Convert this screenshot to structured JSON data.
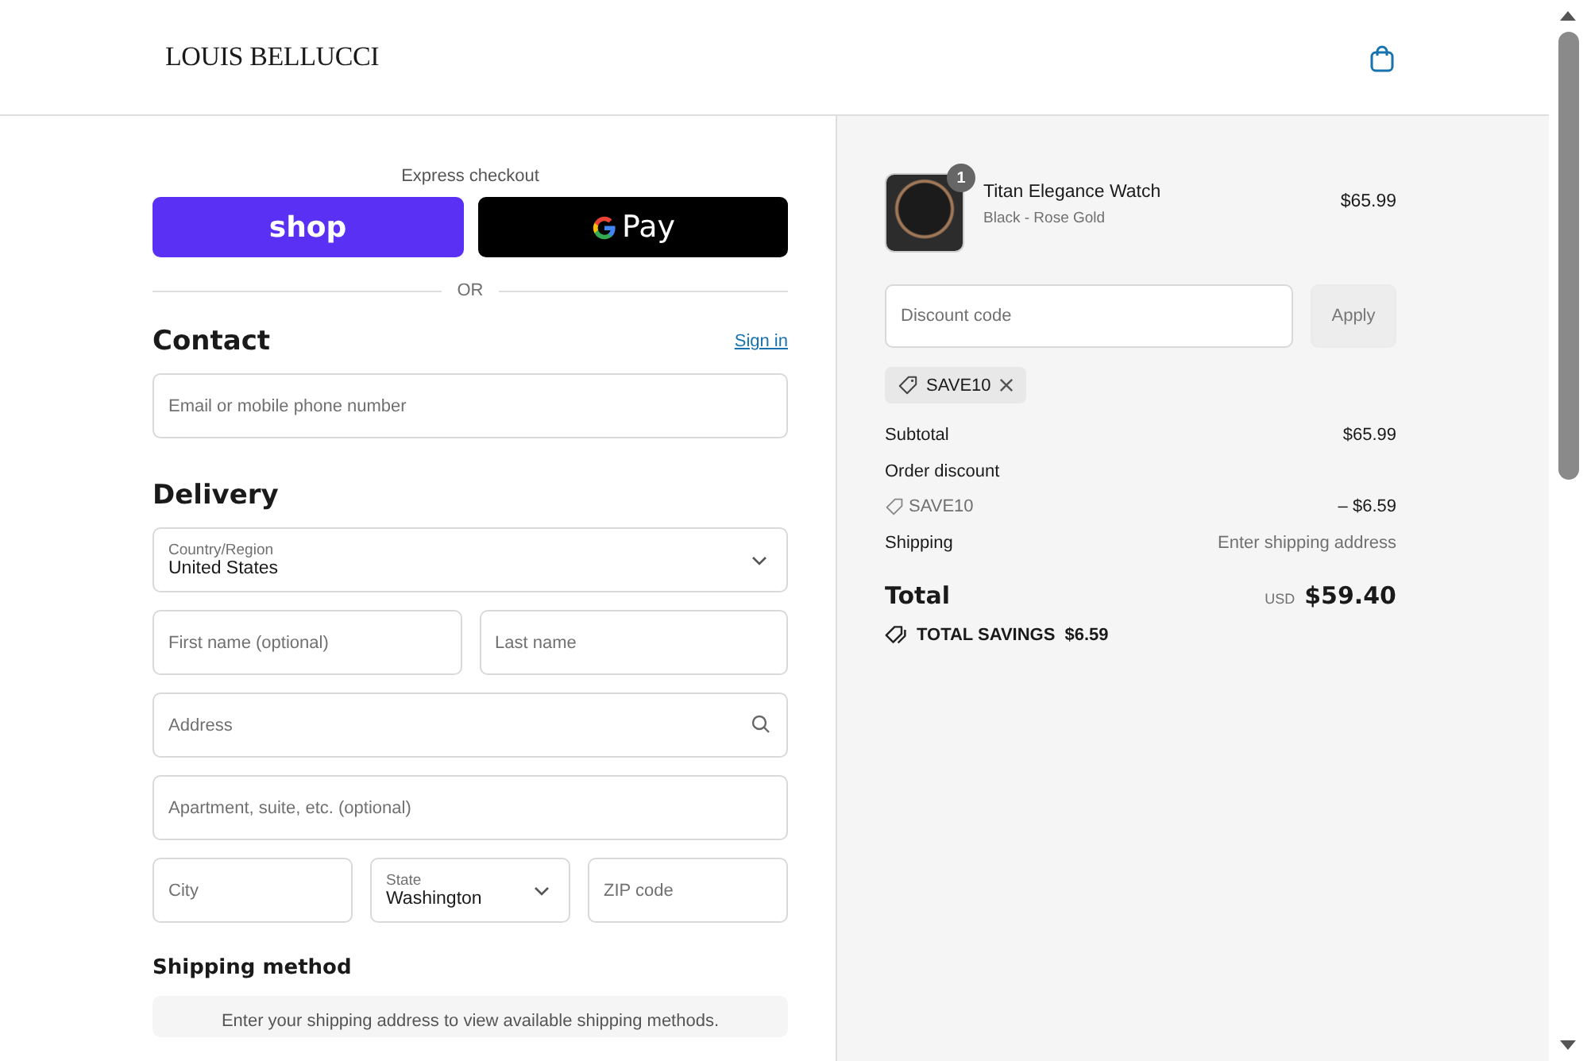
{
  "header": {
    "logo": "LOUIS BELLUCCI"
  },
  "express": {
    "label": "Express checkout",
    "buttons": [
      {
        "kind": "shop",
        "label": "shop"
      },
      {
        "kind": "gpay",
        "label": "Pay"
      }
    ],
    "divider": "OR"
  },
  "contact": {
    "title": "Contact",
    "link": "Sign in",
    "email": {
      "placeholder": "Email or mobile phone number"
    }
  },
  "delivery": {
    "title": "Delivery",
    "rows": [
      [
        {
          "kind": "select",
          "label": "Country/Region",
          "value": "United States"
        }
      ],
      [
        {
          "kind": "text",
          "placeholder": "First name (optional)"
        },
        {
          "kind": "text",
          "placeholder": "Last name"
        }
      ],
      [
        {
          "kind": "search",
          "placeholder": "Address"
        }
      ],
      [
        {
          "kind": "text",
          "placeholder": "Apartment, suite, etc. (optional)"
        }
      ],
      [
        {
          "kind": "text",
          "placeholder": "City"
        },
        {
          "kind": "select",
          "label": "State",
          "value": "Washington"
        },
        {
          "kind": "text",
          "placeholder": "ZIP code"
        }
      ]
    ]
  },
  "shipping_method": {
    "title": "Shipping method",
    "message": "Enter your shipping address to view available shipping methods."
  },
  "summary": {
    "item": {
      "name": "Titan Elegance Watch",
      "variant": "Black - Rose Gold",
      "price": "$65.99",
      "quantity": "1"
    },
    "discount": {
      "placeholder": "Discount code",
      "button": "Apply"
    },
    "applied_codes": [
      {
        "code": "SAVE10"
      }
    ],
    "lines": [
      {
        "kind": "amount",
        "label": "Subtotal",
        "value": "$65.99"
      },
      {
        "kind": "heading",
        "label": "Order discount"
      },
      {
        "kind": "code",
        "label": "SAVE10",
        "value": "– $6.59"
      },
      {
        "kind": "note",
        "label": "Shipping",
        "value": "Enter shipping address"
      }
    ],
    "total": {
      "label": "Total",
      "currency": "USD",
      "amount": "$59.40"
    },
    "savings": {
      "label": "TOTAL SAVINGS",
      "amount": "$6.59"
    }
  }
}
